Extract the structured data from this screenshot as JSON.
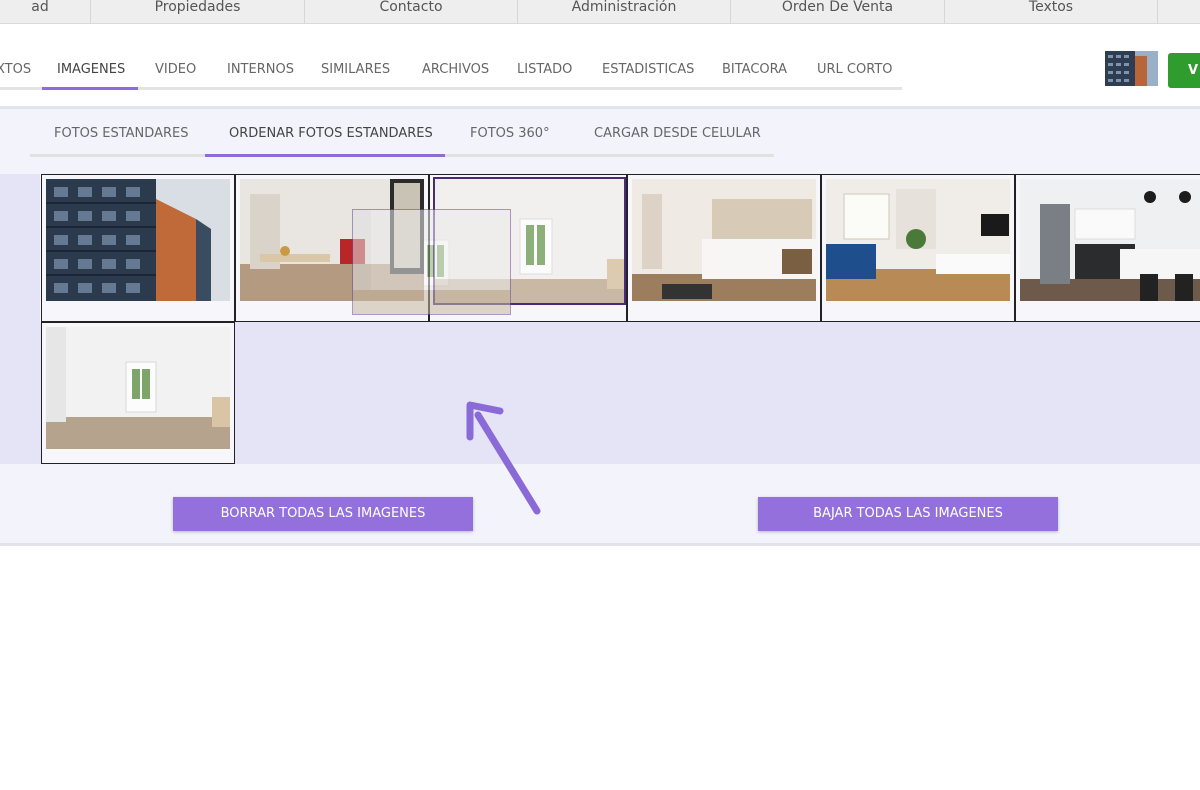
{
  "topnav": {
    "items": [
      "ad",
      "Propiedades",
      "Contacto",
      "Administración",
      "Orden De Venta",
      "Textos"
    ]
  },
  "property_tabs": {
    "items": [
      "XTOS",
      "IMAGENES",
      "VIDEO",
      "INTERNOS",
      "SIMILARES",
      "ARCHIVOS",
      "LISTADO",
      "ESTADISTICAS",
      "BITACORA",
      "URL CORTO"
    ],
    "active": "IMAGENES"
  },
  "header": {
    "green_button_label": "V"
  },
  "image_tabs": {
    "items": [
      "FOTOS ESTANDARES",
      "ORDENAR FOTOS ESTANDARES",
      "FOTOS 360°",
      "CARGAR DESDE CELULAR"
    ],
    "active": "ORDENAR FOTOS ESTANDARES"
  },
  "gallery": {
    "photos": [
      "building-exterior",
      "living-dining-room",
      "empty-room",
      "bedroom",
      "blue-sofa-living-room",
      "kitchen",
      "empty-room"
    ],
    "dragging": "empty-room"
  },
  "actions": {
    "delete_all": "BORRAR TODAS LAS IMAGENES",
    "download_all": "BAJAR TODAS LAS IMAGENES"
  },
  "colors": {
    "accent": "#9370db",
    "tab_underline": "#8e6bd6",
    "green_button": "#2e9d2e",
    "panel_bg": "#f3f3fb"
  }
}
